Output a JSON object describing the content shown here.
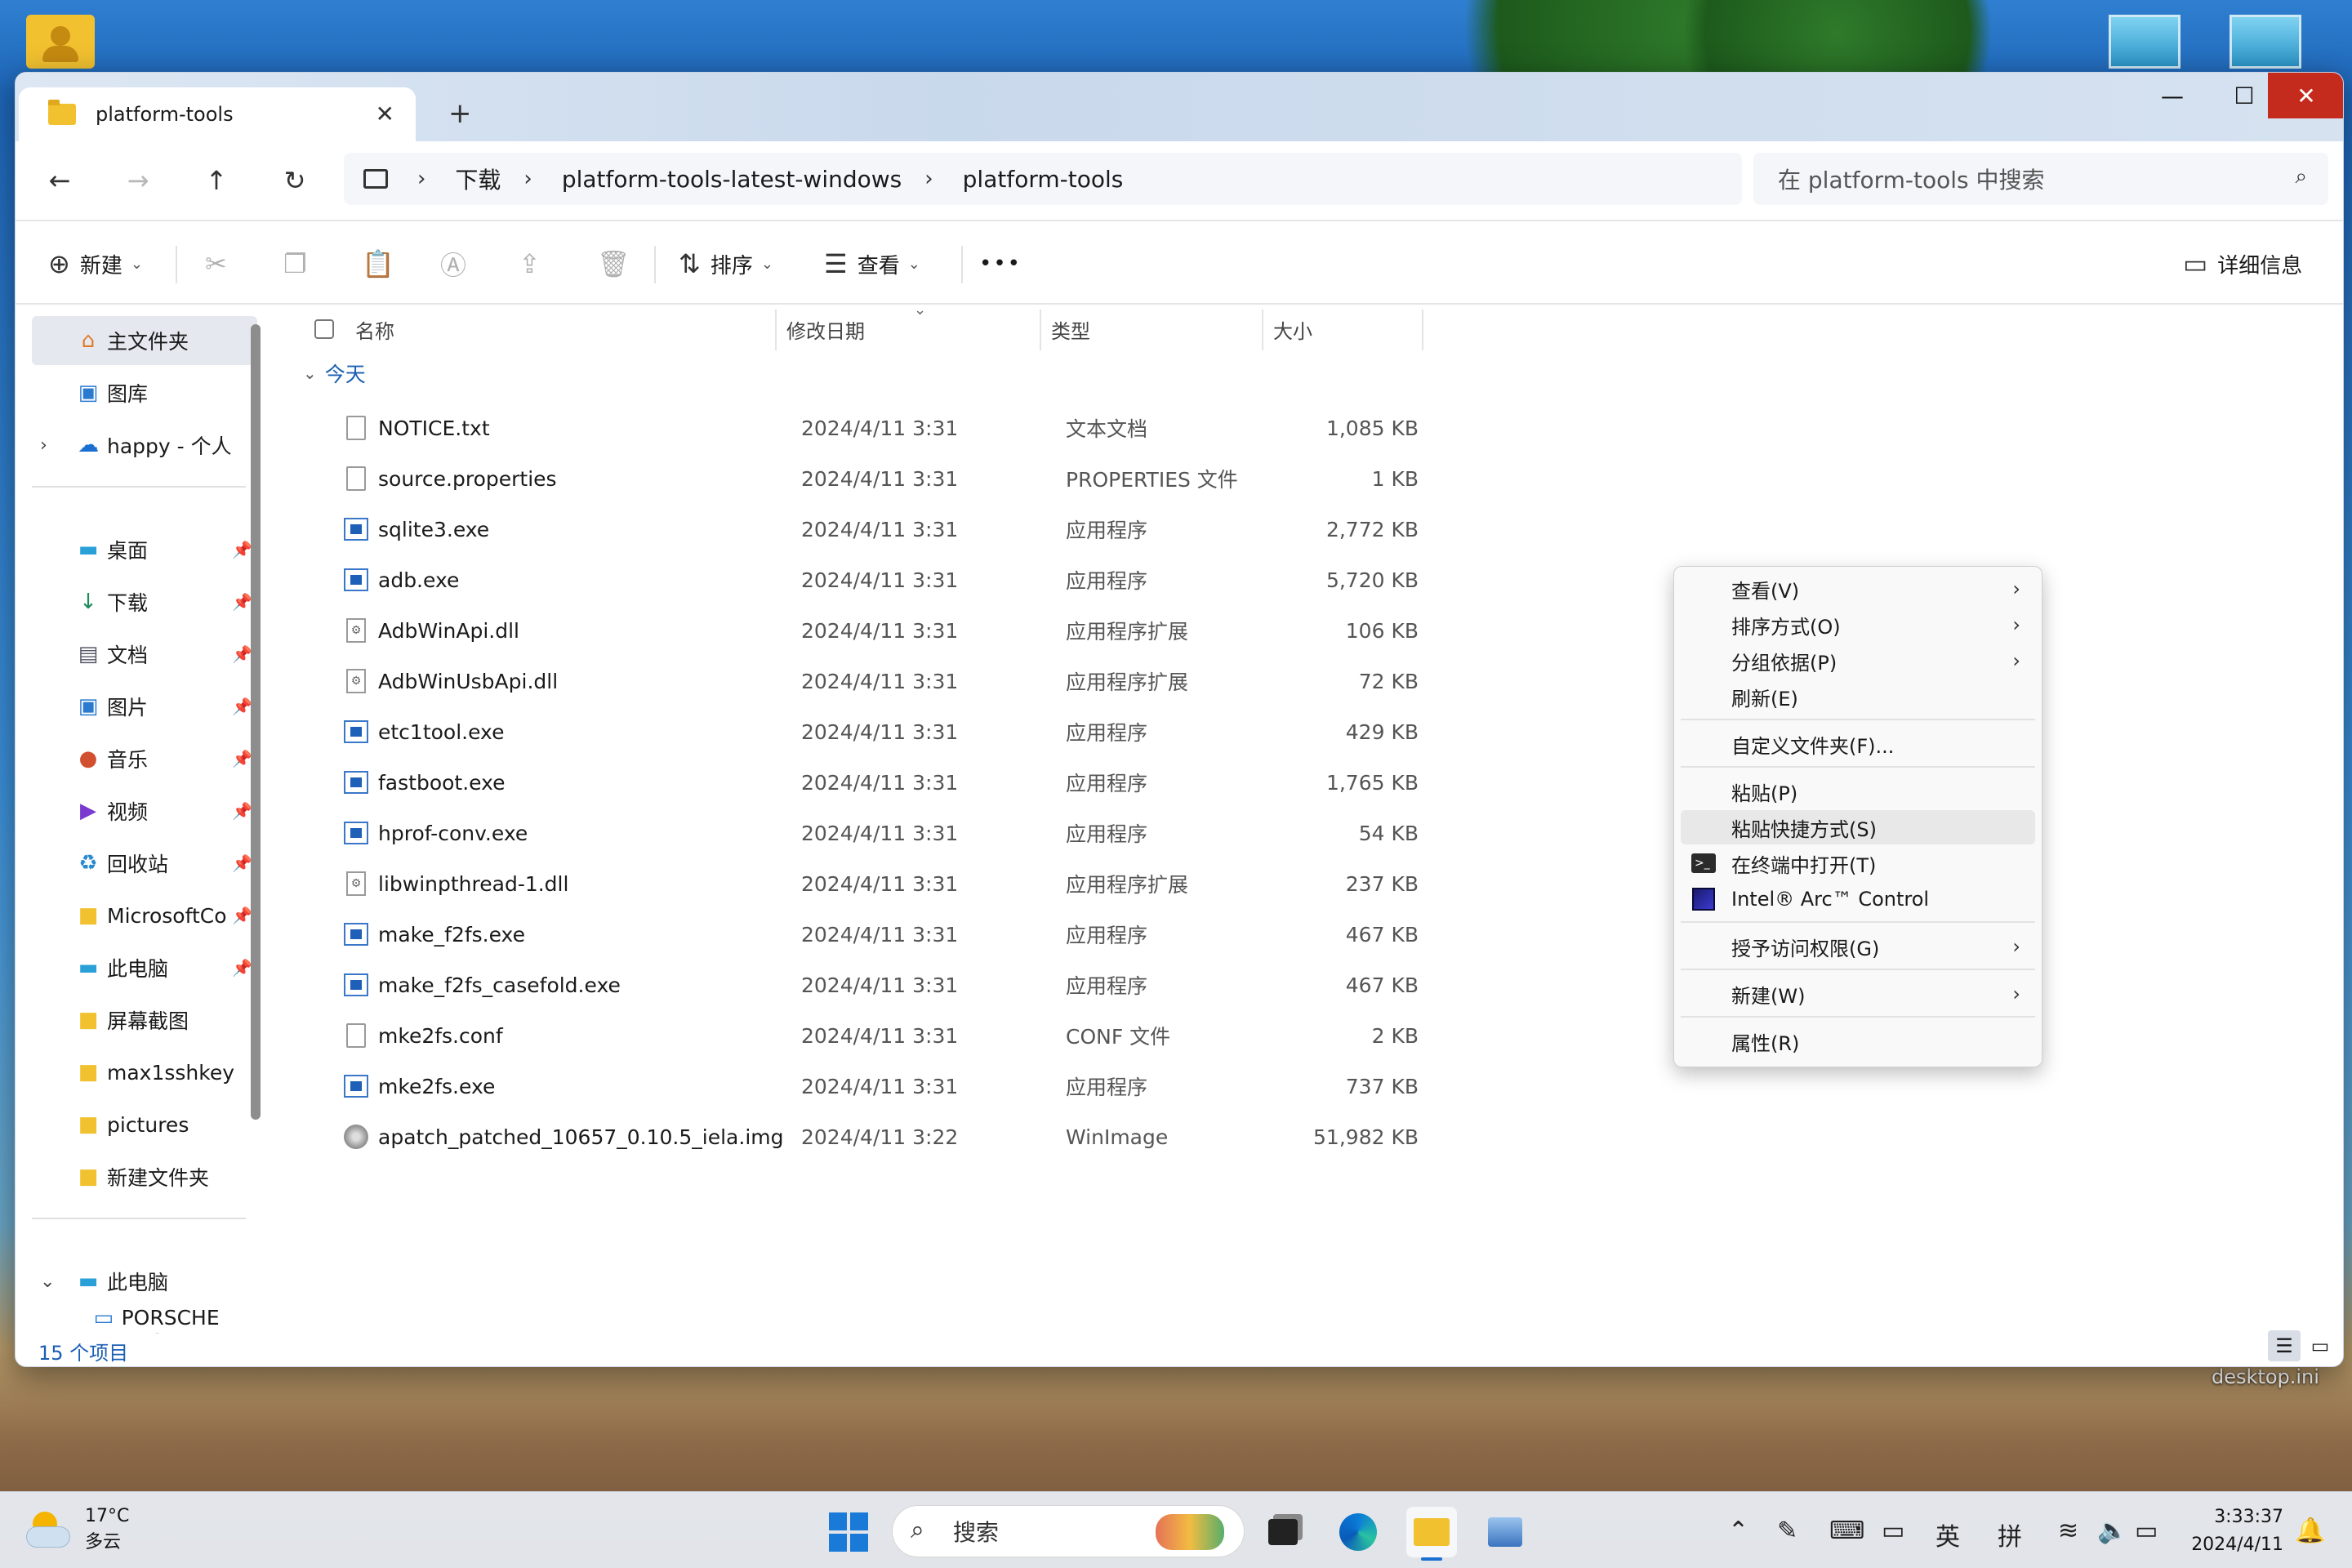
{
  "desktop": {
    "label_desktop_ini": "desktop.ini"
  },
  "window": {
    "tab_title": "platform-tools",
    "tab_close": "✕",
    "new_tab": "+",
    "controls": {
      "minimize": "—",
      "maximize": "☐",
      "close": "✕"
    }
  },
  "navigation": {
    "breadcrumbs": [
      "下载",
      "platform-tools-latest-windows",
      "platform-tools"
    ],
    "search_placeholder": "在 platform-tools 中搜索"
  },
  "toolbar": {
    "new_label": "新建",
    "sort_label": "排序",
    "view_label": "查看",
    "more_label": "•••",
    "details_label": "详细信息"
  },
  "sidebar": {
    "top_items": [
      {
        "label": "主文件夹",
        "icon": "home-icon",
        "selected": true
      },
      {
        "label": "图库",
        "icon": "gallery-icon"
      },
      {
        "label": "happy - 个人",
        "icon": "onedrive-icon"
      }
    ],
    "pinned_items": [
      {
        "label": "桌面",
        "icon": "desktop-icon"
      },
      {
        "label": "下载",
        "icon": "download-icon"
      },
      {
        "label": "文档",
        "icon": "documents-icon"
      },
      {
        "label": "图片",
        "icon": "pictures-icon"
      },
      {
        "label": "音乐",
        "icon": "music-icon"
      },
      {
        "label": "视频",
        "icon": "videos-icon"
      },
      {
        "label": "回收站",
        "icon": "recycle-bin-icon"
      },
      {
        "label": "MicrosoftCo",
        "icon": "folder-icon"
      },
      {
        "label": "此电脑",
        "icon": "pc-icon"
      },
      {
        "label": "屏幕截图",
        "icon": "folder-icon"
      },
      {
        "label": "max1sshkey",
        "icon": "folder-icon"
      },
      {
        "label": "pictures",
        "icon": "folder-icon"
      },
      {
        "label": "新建文件夹",
        "icon": "folder-icon"
      }
    ],
    "this_pc": "此电脑",
    "partial_item": "PORSCHE DFC"
  },
  "columns": {
    "name": "名称",
    "date": "修改日期",
    "type": "类型",
    "size": "大小"
  },
  "group_label": "今天",
  "files": [
    {
      "name": "NOTICE.txt",
      "date": "2024/4/11 3:31",
      "type": "文本文档",
      "size": "1,085 KB",
      "icon": "doc"
    },
    {
      "name": "source.properties",
      "date": "2024/4/11 3:31",
      "type": "PROPERTIES 文件",
      "size": "1 KB",
      "icon": "doc"
    },
    {
      "name": "sqlite3.exe",
      "date": "2024/4/11 3:31",
      "type": "应用程序",
      "size": "2,772 KB",
      "icon": "exe"
    },
    {
      "name": "adb.exe",
      "date": "2024/4/11 3:31",
      "type": "应用程序",
      "size": "5,720 KB",
      "icon": "exe"
    },
    {
      "name": "AdbWinApi.dll",
      "date": "2024/4/11 3:31",
      "type": "应用程序扩展",
      "size": "106 KB",
      "icon": "dll"
    },
    {
      "name": "AdbWinUsbApi.dll",
      "date": "2024/4/11 3:31",
      "type": "应用程序扩展",
      "size": "72 KB",
      "icon": "dll"
    },
    {
      "name": "etc1tool.exe",
      "date": "2024/4/11 3:31",
      "type": "应用程序",
      "size": "429 KB",
      "icon": "exe"
    },
    {
      "name": "fastboot.exe",
      "date": "2024/4/11 3:31",
      "type": "应用程序",
      "size": "1,765 KB",
      "icon": "exe"
    },
    {
      "name": "hprof-conv.exe",
      "date": "2024/4/11 3:31",
      "type": "应用程序",
      "size": "54 KB",
      "icon": "exe"
    },
    {
      "name": "libwinpthread-1.dll",
      "date": "2024/4/11 3:31",
      "type": "应用程序扩展",
      "size": "237 KB",
      "icon": "dll"
    },
    {
      "name": "make_f2fs.exe",
      "date": "2024/4/11 3:31",
      "type": "应用程序",
      "size": "467 KB",
      "icon": "exe"
    },
    {
      "name": "make_f2fs_casefold.exe",
      "date": "2024/4/11 3:31",
      "type": "应用程序",
      "size": "467 KB",
      "icon": "exe"
    },
    {
      "name": "mke2fs.conf",
      "date": "2024/4/11 3:31",
      "type": "CONF 文件",
      "size": "2 KB",
      "icon": "doc"
    },
    {
      "name": "mke2fs.exe",
      "date": "2024/4/11 3:31",
      "type": "应用程序",
      "size": "737 KB",
      "icon": "exe"
    },
    {
      "name": "apatch_patched_10657_0.10.5_iela.img",
      "date": "2024/4/11 3:22",
      "type": "WinImage",
      "size": "51,982 KB",
      "icon": "img"
    }
  ],
  "status": {
    "item_count": "15 个项目"
  },
  "context_menu": {
    "items": [
      {
        "label": "查看(V)",
        "submenu": true
      },
      {
        "label": "排序方式(O)",
        "submenu": true
      },
      {
        "label": "分组依据(P)",
        "submenu": true
      },
      {
        "label": "刷新(E)"
      },
      {
        "label": "自定义文件夹(F)..."
      },
      {
        "label": "粘贴(P)"
      },
      {
        "label": "粘贴快捷方式(S)",
        "hover": true
      },
      {
        "label": "在终端中打开(T)",
        "icon": "terminal-icon"
      },
      {
        "label": "Intel® Arc™ Control",
        "icon": "intel-arc-icon"
      },
      {
        "label": "授予访问权限(G)",
        "submenu": true
      },
      {
        "label": "新建(W)",
        "submenu": true
      },
      {
        "label": "属性(R)"
      }
    ]
  },
  "taskbar": {
    "weather_temp": "17°C",
    "weather_desc": "多云",
    "search_label": "搜索",
    "ime_lang": "英",
    "ime_mode": "拼",
    "time": "3:33:37",
    "date": "2024/4/11"
  },
  "colors": {
    "accent": "#1a5fb4",
    "close_red": "#c42b1c",
    "folder": "#f2c130"
  }
}
